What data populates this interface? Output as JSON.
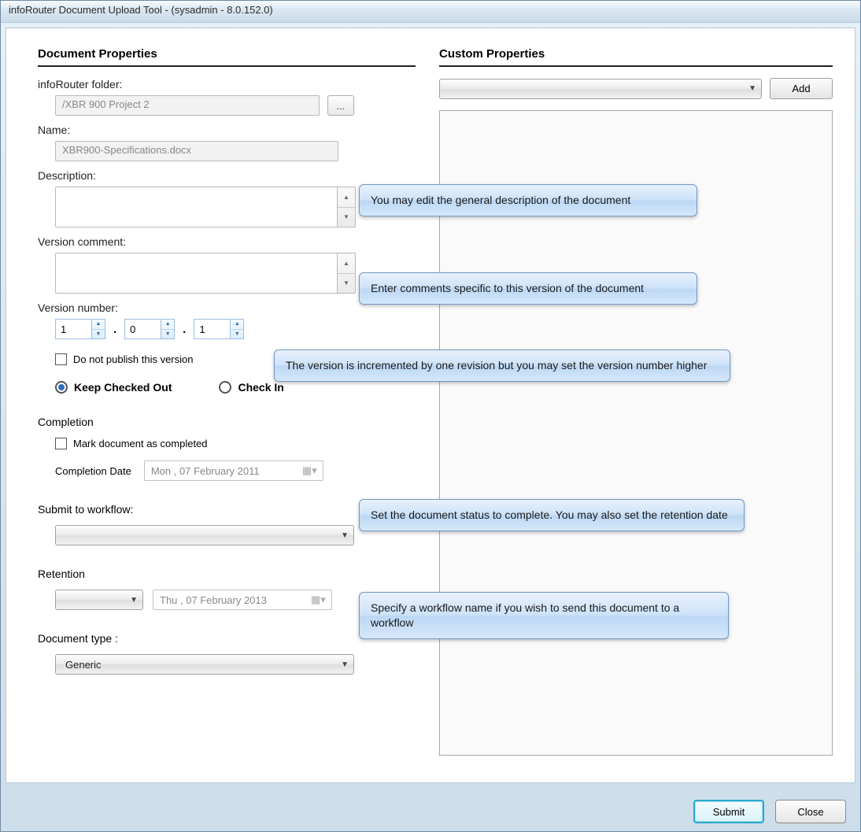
{
  "window": {
    "title": "infoRouter Document Upload Tool - (sysadmin - 8.0.152.0)"
  },
  "left": {
    "header": "Document Properties",
    "folder_label": "infoRouter folder:",
    "folder_value": "/XBR 900 Project 2",
    "browse_label": "...",
    "name_label": "Name:",
    "name_value": "XBR900-Specifications.docx",
    "description_label": "Description:",
    "description_value": "",
    "version_comment_label": "Version comment:",
    "version_comment_value": "",
    "version_number_label": "Version number:",
    "version": {
      "major": "1",
      "minor": "0",
      "rev": "1"
    },
    "dot": ".",
    "do_not_publish_label": "Do not publish this version",
    "do_not_publish_checked": false,
    "keep_checked_out_label": "Keep Checked Out",
    "check_in_label": "Check In",
    "version_action": "keep",
    "completion_header": "Completion",
    "mark_completed_label": "Mark document as completed",
    "mark_completed_checked": false,
    "completion_date_label": "Completion Date",
    "completion_date_value": "Mon , 07  February  2011",
    "submit_workflow_label": "Submit to workflow:",
    "workflow_value": "",
    "retention_label": "Retention",
    "retention_type_value": "",
    "retention_date_value": "Thu , 07  February  2013",
    "doctype_label": "Document type :",
    "doctype_value": "Generic"
  },
  "right": {
    "header": "Custom Properties",
    "combo_value": "",
    "add_label": "Add"
  },
  "callouts": {
    "c1": "You may edit the general description of the document",
    "c2": "Enter comments specific to this version of the document",
    "c3": "The version is incremented by one revision but you may set the version number higher",
    "c4": "Set the document status to complete. You may also set the retention date",
    "c5": "Specify a workflow name if you wish to send this document to a workflow"
  },
  "buttons": {
    "submit": "Submit",
    "close": "Close"
  }
}
